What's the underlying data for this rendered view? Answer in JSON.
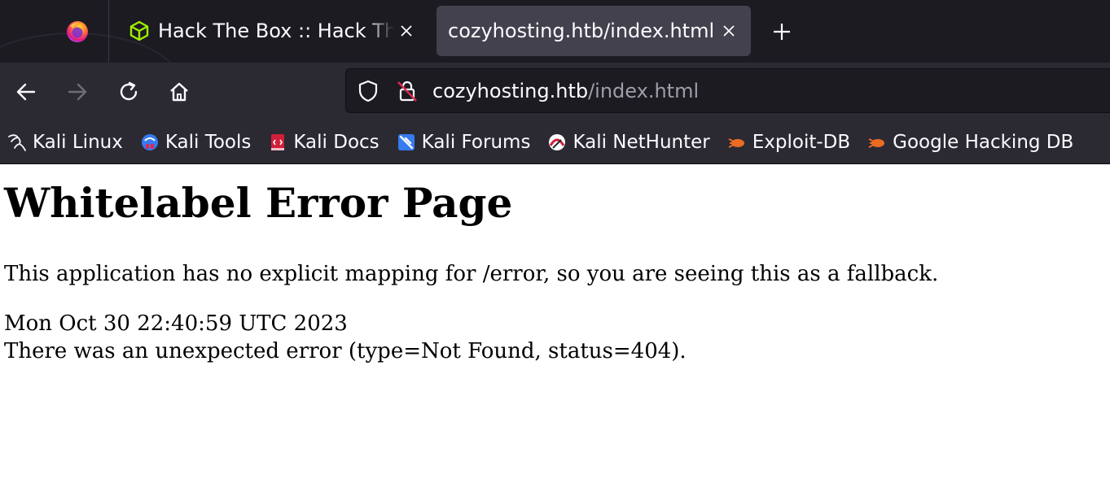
{
  "tabs": [
    {
      "title": "Hack The Box :: Hack The Box",
      "active": false
    },
    {
      "title": "cozyhosting.htb/index.html",
      "active": true
    }
  ],
  "urlbar": {
    "domain": "cozyhosting.htb",
    "path": "/index.html"
  },
  "bookmarks": [
    {
      "label": "Kali Linux",
      "icon": "kali-dragon-icon"
    },
    {
      "label": "Kali Tools",
      "icon": "kali-tools-icon"
    },
    {
      "label": "Kali Docs",
      "icon": "kali-docs-icon"
    },
    {
      "label": "Kali Forums",
      "icon": "kali-forums-icon"
    },
    {
      "label": "Kali NetHunter",
      "icon": "kali-nethunter-icon"
    },
    {
      "label": "Exploit-DB",
      "icon": "exploit-db-icon"
    },
    {
      "label": "Google Hacking DB",
      "icon": "google-hacking-db-icon"
    }
  ],
  "page": {
    "heading": "Whitelabel Error Page",
    "message": "This application has no explicit mapping for /error, so you are seeing this as a fallback.",
    "timestamp": "Mon Oct 30 22:40:59 UTC 2023",
    "error": "There was an unexpected error (type=Not Found, status=404)."
  },
  "colors": {
    "chrome_dark": "#1c1b22",
    "toolbar": "#2b2a33",
    "active_tab": "#42414d",
    "htb_green": "#9fef00"
  }
}
